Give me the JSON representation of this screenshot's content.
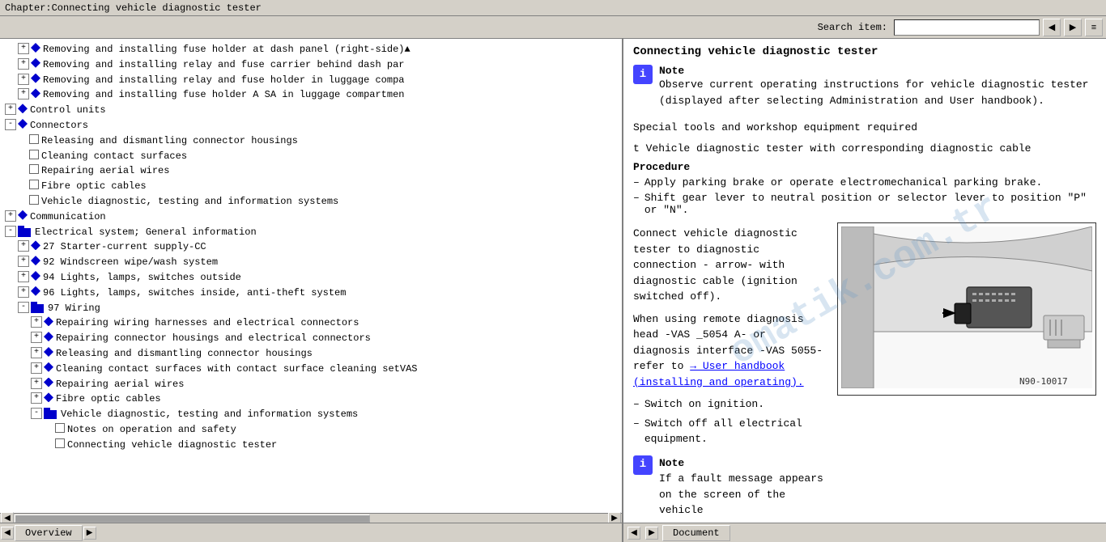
{
  "titleBar": {
    "text": "Chapter:Connecting vehicle diagnostic tester"
  },
  "toolbar": {
    "searchLabel": "Search item:",
    "searchPlaceholder": "",
    "buttons": [
      "◀",
      "▶",
      "≡▼"
    ]
  },
  "leftPanel": {
    "treeItems": [
      {
        "indent": 1,
        "type": "doc-expand",
        "icon": "+",
        "text": "Removing and installing fuse holder at dash panel (right-side)",
        "expanded": false
      },
      {
        "indent": 1,
        "type": "doc-expand",
        "icon": "+",
        "text": "Removing and installing relay and fuse carrier behind dash pa",
        "expanded": false
      },
      {
        "indent": 1,
        "type": "doc-expand",
        "icon": "+",
        "text": "Removing and installing relay and fuse holder in luggage comp",
        "expanded": false
      },
      {
        "indent": 1,
        "type": "doc-expand",
        "icon": "+",
        "text": "Removing and installing fuse holder A SA in luggage compartme",
        "expanded": false
      },
      {
        "indent": 0,
        "type": "folder-expand",
        "icon": "+",
        "text": "Control units",
        "expanded": false
      },
      {
        "indent": 0,
        "type": "folder-expand",
        "icon": "-",
        "text": "Connectors",
        "expanded": true
      },
      {
        "indent": 1,
        "type": "doc",
        "text": "Releasing and dismantling connector housings"
      },
      {
        "indent": 1,
        "type": "doc",
        "text": "Cleaning contact surfaces"
      },
      {
        "indent": 1,
        "type": "doc",
        "text": "Repairing aerial wires"
      },
      {
        "indent": 1,
        "type": "doc",
        "text": "Fibre optic cables"
      },
      {
        "indent": 1,
        "type": "doc",
        "text": "Vehicle diagnostic, testing and information systems"
      },
      {
        "indent": 0,
        "type": "folder-expand",
        "icon": "+",
        "text": "Communication",
        "expanded": false
      },
      {
        "indent": 0,
        "type": "folder-expand",
        "icon": "+",
        "text": "Electrical system; General information",
        "expanded": false
      },
      {
        "indent": 0,
        "type": "folder-expand",
        "icon": "-",
        "text": "Electrical system; General information",
        "expanded": true,
        "hide": true
      },
      {
        "indent": 1,
        "type": "folder-expand",
        "icon": "+",
        "text": "27 Starter-current supply-CC",
        "expanded": false
      },
      {
        "indent": 1,
        "type": "folder-expand",
        "icon": "+",
        "text": "92 Windscreen wipe/wash system",
        "expanded": false
      },
      {
        "indent": 1,
        "type": "folder-expand",
        "icon": "+",
        "text": "94 Lights, lamps, switches outside",
        "expanded": false
      },
      {
        "indent": 1,
        "type": "folder-expand",
        "icon": "+",
        "text": "96 Lights, lamps, switches inside, anti-theft system",
        "expanded": false
      },
      {
        "indent": 1,
        "type": "folder-expand",
        "icon": "-",
        "text": "97 Wiring",
        "expanded": true
      },
      {
        "indent": 2,
        "type": "doc-expand",
        "icon": "+",
        "text": "Repairing wiring harnesses and electrical connectors"
      },
      {
        "indent": 2,
        "type": "doc-expand",
        "icon": "+",
        "text": "Repairing connector housings and electrical connectors"
      },
      {
        "indent": 2,
        "type": "doc-expand",
        "icon": "+",
        "text": "Releasing and dismantling connector housings"
      },
      {
        "indent": 2,
        "type": "doc-expand",
        "icon": "+",
        "text": "Cleaning contact surfaces with contact surface cleaning setVAS"
      },
      {
        "indent": 2,
        "type": "doc-expand",
        "icon": "+",
        "text": "Repairing aerial wires"
      },
      {
        "indent": 2,
        "type": "doc-expand",
        "icon": "+",
        "text": "Fibre optic cables"
      },
      {
        "indent": 2,
        "type": "folder-expand",
        "icon": "-",
        "text": "Vehicle diagnostic, testing and information systems",
        "expanded": true
      },
      {
        "indent": 3,
        "type": "doc",
        "text": "Notes on operation and safety"
      },
      {
        "indent": 3,
        "type": "doc",
        "text": "Connecting vehicle diagnostic tester"
      }
    ]
  },
  "rightPanel": {
    "title": "Connecting vehicle diagnostic tester",
    "note1Label": "Note",
    "note1Text": "Observe current operating instructions for vehicle diagnostic tester (displayed after selecting Administration and User handbook).",
    "specialToolsLabel": "Special tools and workshop equipment required",
    "specialToolsItem": "t  Vehicle diagnostic tester with corresponding diagnostic cable",
    "procedureLabel": "Procedure",
    "bulletItems": [
      "Apply parking brake or operate electromechanical parking brake.",
      "Shift gear lever to neutral position or selector lever to position \"P\" or \"N\"."
    ],
    "connectText": "Connect vehicle diagnostic tester to diagnostic connection - arrow- with diagnostic cable (ignition switched off).",
    "remoteText": "When using remote diagnosis head -VAS _5054 A- or diagnosis interface -VAS 5055- refer to",
    "linkText": "→ User handbook (installing and operating).",
    "switchOnText": "Switch on ignition.",
    "switchOffText": "Switch off all electrical equipment.",
    "note2Label": "Note",
    "note2Text": "If a fault message appears on the screen of the vehicle",
    "diagramLabel": "N90-10017",
    "arrowLabel": "arrow - With diagnostic"
  },
  "statusBar": {
    "leftTab": "Overview",
    "rightTab": "Document"
  }
}
